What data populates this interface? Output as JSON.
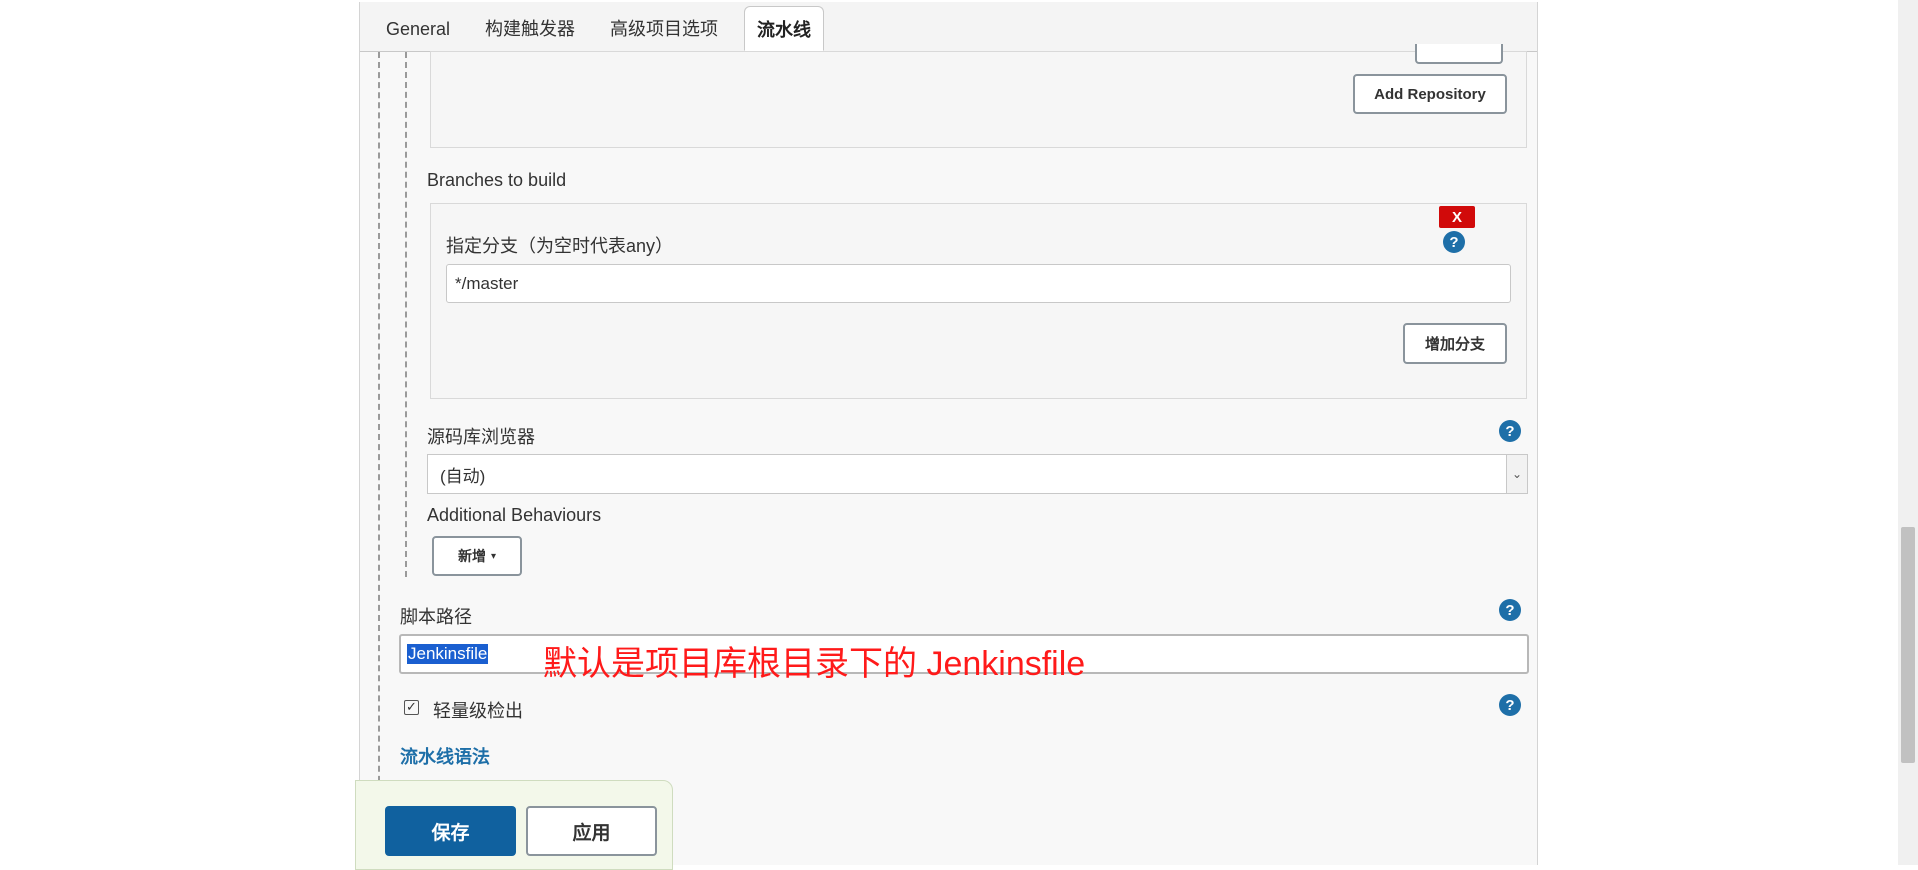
{
  "tabs": [
    {
      "label": "General"
    },
    {
      "label": "构建触发器"
    },
    {
      "label": "高级项目选项"
    },
    {
      "label": "流水线"
    }
  ],
  "repository": {
    "add_repository_label": "Add Repository"
  },
  "branches": {
    "section_label": "Branches to build",
    "delete_label": "X",
    "branch_field_label": "指定分支（为空时代表any）",
    "branch_value": "*/master",
    "add_branch_label": "增加分支"
  },
  "browser": {
    "label": "源码库浏览器",
    "selected": "(自动)"
  },
  "behaviours": {
    "label": "Additional Behaviours",
    "add_label": "新增"
  },
  "script_path": {
    "label": "脚本路径",
    "value": "Jenkinsfile",
    "annotation": "默认是项目库根目录下的 Jenkinsfile"
  },
  "lightweight": {
    "label": "轻量级检出",
    "checked": true,
    "check_mark": "✓"
  },
  "pipeline_syntax_label": "流水线语法",
  "help_glyph": "?",
  "dropdown_glyph": "⌄",
  "caret_glyph": "▾",
  "footer": {
    "save_label": "保存",
    "apply_label": "应用"
  },
  "colors": {
    "primary": "#10619f",
    "help_icon": "#1e6fa8",
    "delete": "#d10a0a",
    "annotation": "#ff1a1a",
    "footer_bg": "#f3f8ea"
  }
}
